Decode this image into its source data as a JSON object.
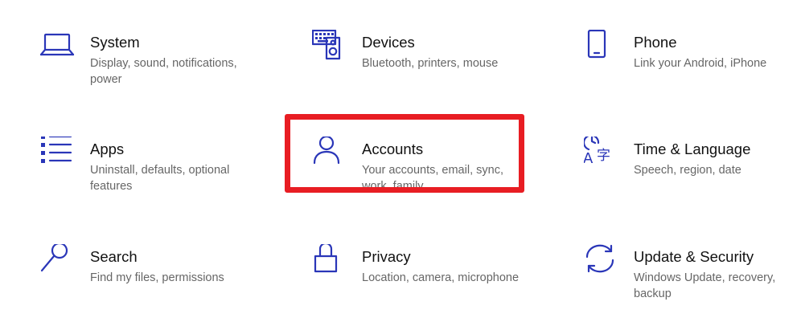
{
  "tiles": [
    {
      "title": "System",
      "description": "Display, sound, notifications, power",
      "icon": "laptop-icon"
    },
    {
      "title": "Devices",
      "description": "Bluetooth, printers, mouse",
      "icon": "devices-icon"
    },
    {
      "title": "Phone",
      "description": "Link your Android, iPhone",
      "icon": "phone-icon"
    },
    {
      "title": "Apps",
      "description": "Uninstall, defaults, optional features",
      "icon": "apps-list-icon"
    },
    {
      "title": "Accounts",
      "description": "Your accounts, email, sync, work, family",
      "icon": "person-icon"
    },
    {
      "title": "Time & Language",
      "description": "Speech, region, date",
      "icon": "time-language-icon"
    },
    {
      "title": "Search",
      "description": "Find my files, permissions",
      "icon": "search-icon"
    },
    {
      "title": "Privacy",
      "description": "Location, camera, microphone",
      "icon": "lock-icon"
    },
    {
      "title": "Update & Security",
      "description": "Windows Update, recovery, backup",
      "icon": "sync-arrows-icon"
    }
  ],
  "colors": {
    "icon": "#2a36b8",
    "title": "#111111",
    "description": "#666666",
    "highlight": "#e81d23"
  },
  "icon_glyphs": {
    "clock_letter": "A",
    "lang_char": "字"
  }
}
